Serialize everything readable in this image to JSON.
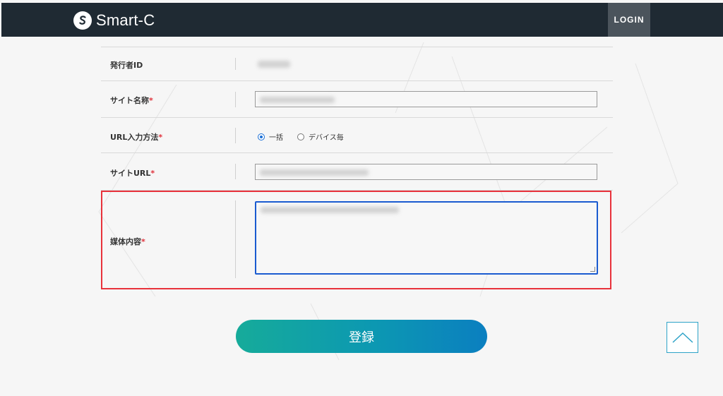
{
  "header": {
    "brand": "Smart-C",
    "login_label": "LOGIN",
    "background_color": "#1f2a33"
  },
  "form": {
    "fields": [
      {
        "label": "発行者ID",
        "required": false,
        "type": "readonly"
      },
      {
        "label": "サイト名称",
        "required": true,
        "type": "text"
      },
      {
        "label": "URL入力方法",
        "required": true,
        "type": "radio",
        "options": [
          "一括",
          "デバイス毎"
        ],
        "selected": "一括"
      },
      {
        "label": "サイトURL",
        "required": true,
        "type": "text"
      },
      {
        "label": "媒体内容",
        "required": true,
        "type": "textarea"
      }
    ],
    "required_mark": "*"
  },
  "submit_label": "登録",
  "icons": {
    "logo": "logo-s-icon",
    "scroll_top": "chevron-up-icon"
  },
  "colors": {
    "accent": "#1a6fd6",
    "required": "#e0313b",
    "highlight": "#e8323b",
    "submit_gradient_start": "#16ab9a",
    "submit_gradient_end": "#0b7fc0",
    "scroll_top_border": "#2ea3c8"
  }
}
